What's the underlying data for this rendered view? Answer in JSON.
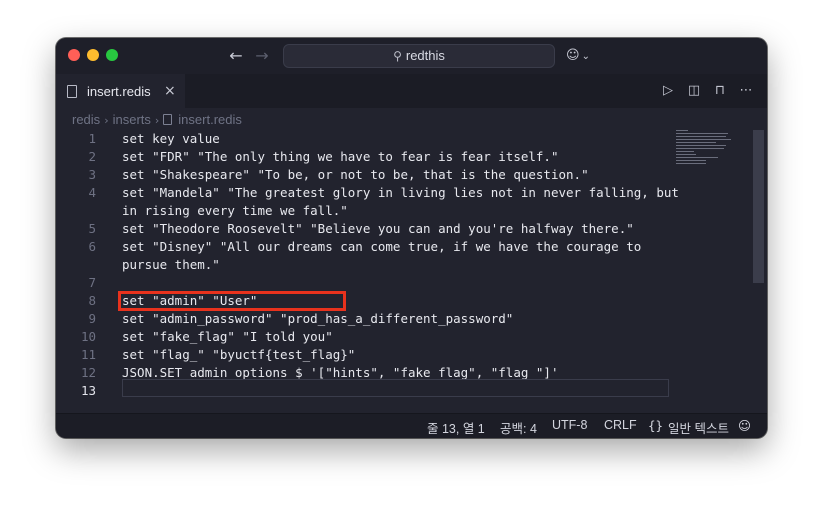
{
  "titlebar": {
    "back_icon": "arrow-left-icon",
    "forward_icon": "arrow-right-icon",
    "search_text": "redthis",
    "search_icon": "search-icon",
    "copilot_icon": "copilot-icon"
  },
  "tab": {
    "label": "insert.redis",
    "close": "×"
  },
  "tab_actions": [
    "run-icon",
    "split-editor-icon",
    "unlock-icon",
    "more-icon"
  ],
  "breadcrumb": {
    "items": [
      "redis",
      "inserts",
      "insert.redis"
    ]
  },
  "editor": {
    "lines": [
      {
        "num": "1",
        "text": "set key value"
      },
      {
        "num": "2",
        "text": "set \"FDR\" \"The only thing we have to fear is fear itself.\""
      },
      {
        "num": "3",
        "text": "set \"Shakespeare\" \"To be, or not to be, that is the question.\""
      },
      {
        "num": "4",
        "text": "set \"Mandela\" \"The greatest glory in living lies not in never falling, but"
      },
      {
        "num": "",
        "text": "in rising every time we fall.\""
      },
      {
        "num": "5",
        "text": "set \"Theodore Roosevelt\" \"Believe you can and you're halfway there.\""
      },
      {
        "num": "6",
        "text": "set \"Disney\" \"All our dreams can come true, if we have the courage to"
      },
      {
        "num": "",
        "text": "pursue them.\""
      },
      {
        "num": "7",
        "text": ""
      },
      {
        "num": "8",
        "text": "set \"admin\" \"User\""
      },
      {
        "num": "9",
        "text": "set \"admin_password\" \"prod_has_a_different_password\""
      },
      {
        "num": "10",
        "text": "set \"fake_flag\" \"I told you\""
      },
      {
        "num": "11",
        "text": "set \"flag_\" \"byuctf{test_flag}\""
      },
      {
        "num": "12",
        "text": "JSON.SET admin_options $ '[\"hints\", \"fake_flag\", \"flag_\"]'"
      },
      {
        "num": "13",
        "text": ""
      }
    ],
    "highlight_color": "#e8321d"
  },
  "statusbar": {
    "position": "줄 13, 열 1",
    "spaces": "공백: 4",
    "encoding": "UTF-8",
    "eol": "CRLF",
    "language": "일반 텍스트",
    "language_icon": "braces-icon",
    "copilot_icon": "copilot-icon"
  }
}
